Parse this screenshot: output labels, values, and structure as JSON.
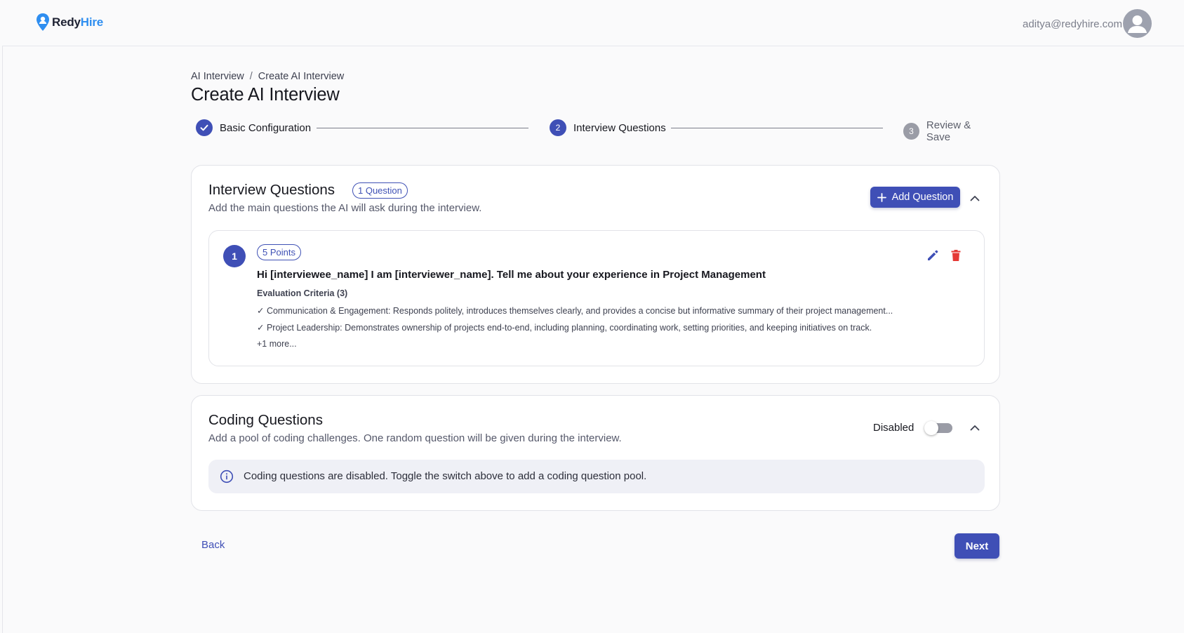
{
  "brand": {
    "name_part1": "Redy",
    "name_part2": "Hire",
    "primary_color": "#3f4fb6",
    "logo_color": "#2f8ef0"
  },
  "header": {
    "user_email": "aditya@redyhire.com"
  },
  "breadcrumb": {
    "items": [
      "AI Interview",
      "Create AI Interview"
    ],
    "separator": "/"
  },
  "page": {
    "title": "Create AI Interview"
  },
  "stepper": {
    "steps": [
      {
        "label": "Basic Configuration",
        "state": "completed",
        "number": "1"
      },
      {
        "label": "Interview Questions",
        "state": "active",
        "number": "2"
      },
      {
        "label": "Review & Save",
        "state": "inactive",
        "number": "3"
      }
    ]
  },
  "interview_questions": {
    "title": "Interview Questions",
    "count_chip": "1 Question",
    "subtitle": "Add the main questions the AI will ask during the interview.",
    "add_button": "Add Question",
    "questions": [
      {
        "number": "1",
        "points": "5 Points",
        "text": "Hi [interviewee_name] I am [interviewer_name]. Tell me about your experience in Project Management",
        "criteria_title": "Evaluation Criteria (3)",
        "criteria": [
          "✓ Communication & Engagement: Responds politely, introduces themselves clearly, and provides a concise but informative summary of their project management...",
          "✓ Project Leadership: Demonstrates ownership of projects end-to-end, including planning, coordinating work, setting priorities, and keeping initiatives on track."
        ],
        "more": "+1 more..."
      }
    ]
  },
  "coding_questions": {
    "title": "Coding Questions",
    "subtitle": "Add a pool of coding challenges. One random question will be given during the interview.",
    "toggle_label": "Disabled",
    "toggle_on": false,
    "info": "Coding questions are disabled. Toggle the switch above to add a coding question pool."
  },
  "footer": {
    "back": "Back",
    "next": "Next"
  }
}
